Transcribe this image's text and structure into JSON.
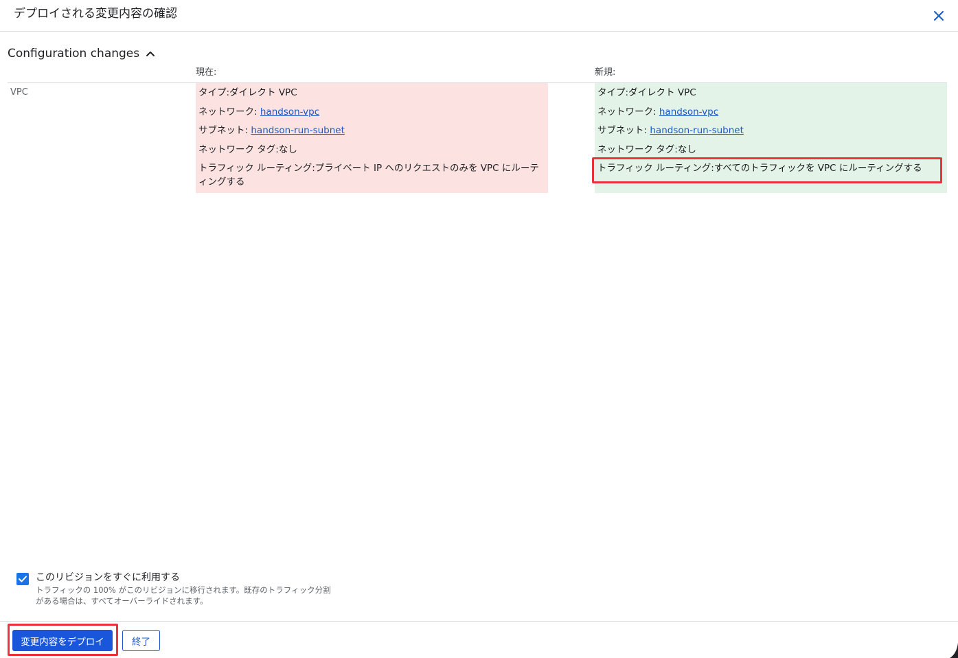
{
  "dialog": {
    "title": "デプロイされる変更内容の確認",
    "close_icon": "close-icon"
  },
  "section": {
    "title": "Configuration changes",
    "toggle_icon": "chevron-up-icon"
  },
  "columns": {
    "current_header": "現在:",
    "new_header": "新規:"
  },
  "vpc_row": {
    "label": "VPC",
    "current": {
      "type_label": "タイプ:",
      "type_value": "ダイレクト VPC",
      "network_label": "ネットワーク:",
      "network_value": "handson-vpc",
      "subnet_label": "サブネット:",
      "subnet_value": "handson-run-subnet",
      "tags_label": "ネットワーク タグ:",
      "tags_value": "なし",
      "routing_label": "トラフィック ルーティング:",
      "routing_value": "プライベート IP へのリクエストのみを VPC にルーティングする"
    },
    "new": {
      "type_label": "タイプ:",
      "type_value": "ダイレクト VPC",
      "network_label": "ネットワーク:",
      "network_value": "handson-vpc",
      "subnet_label": "サブネット:",
      "subnet_value": "handson-run-subnet",
      "tags_label": "ネットワーク タグ:",
      "tags_value": "なし",
      "routing_label": "トラフィック ルーティング:",
      "routing_value": "すべてのトラフィックを VPC にルーティングする"
    }
  },
  "serve_revision": {
    "checked": true,
    "label": "このリビジョンをすぐに利用する",
    "help": "トラフィックの 100% がこのリビジョンに移行されます。既存のトラフィック分割がある場合は、すべてオーバーライドされます。"
  },
  "footer": {
    "deploy_label": "変更内容をデプロイ",
    "close_label": "終了"
  },
  "colors": {
    "accent": "#1a73e8",
    "removed_bg": "#fce3e1",
    "added_bg": "#e4f3e8",
    "highlight": "#e8323c",
    "link": "#1a56c8"
  }
}
